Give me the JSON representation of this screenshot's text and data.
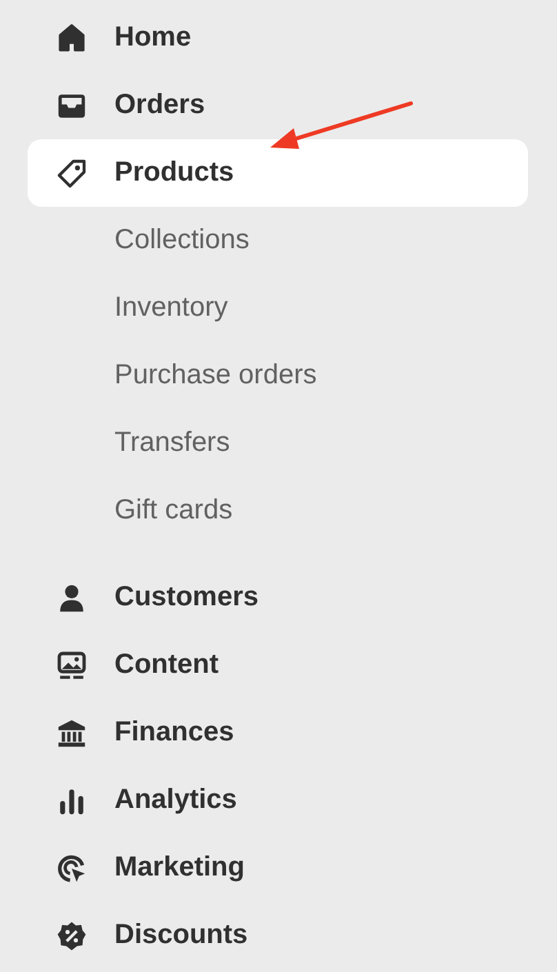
{
  "nav": [
    {
      "label": "Home",
      "selected": false
    },
    {
      "label": "Orders",
      "selected": false
    },
    {
      "label": "Products",
      "selected": true,
      "children": [
        {
          "label": "Collections"
        },
        {
          "label": "Inventory"
        },
        {
          "label": "Purchase orders"
        },
        {
          "label": "Transfers"
        },
        {
          "label": "Gift cards"
        }
      ]
    },
    {
      "label": "Customers",
      "selected": false
    },
    {
      "label": "Content",
      "selected": false
    },
    {
      "label": "Finances",
      "selected": false
    },
    {
      "label": "Analytics",
      "selected": false
    },
    {
      "label": "Marketing",
      "selected": false
    },
    {
      "label": "Discounts",
      "selected": false
    }
  ]
}
